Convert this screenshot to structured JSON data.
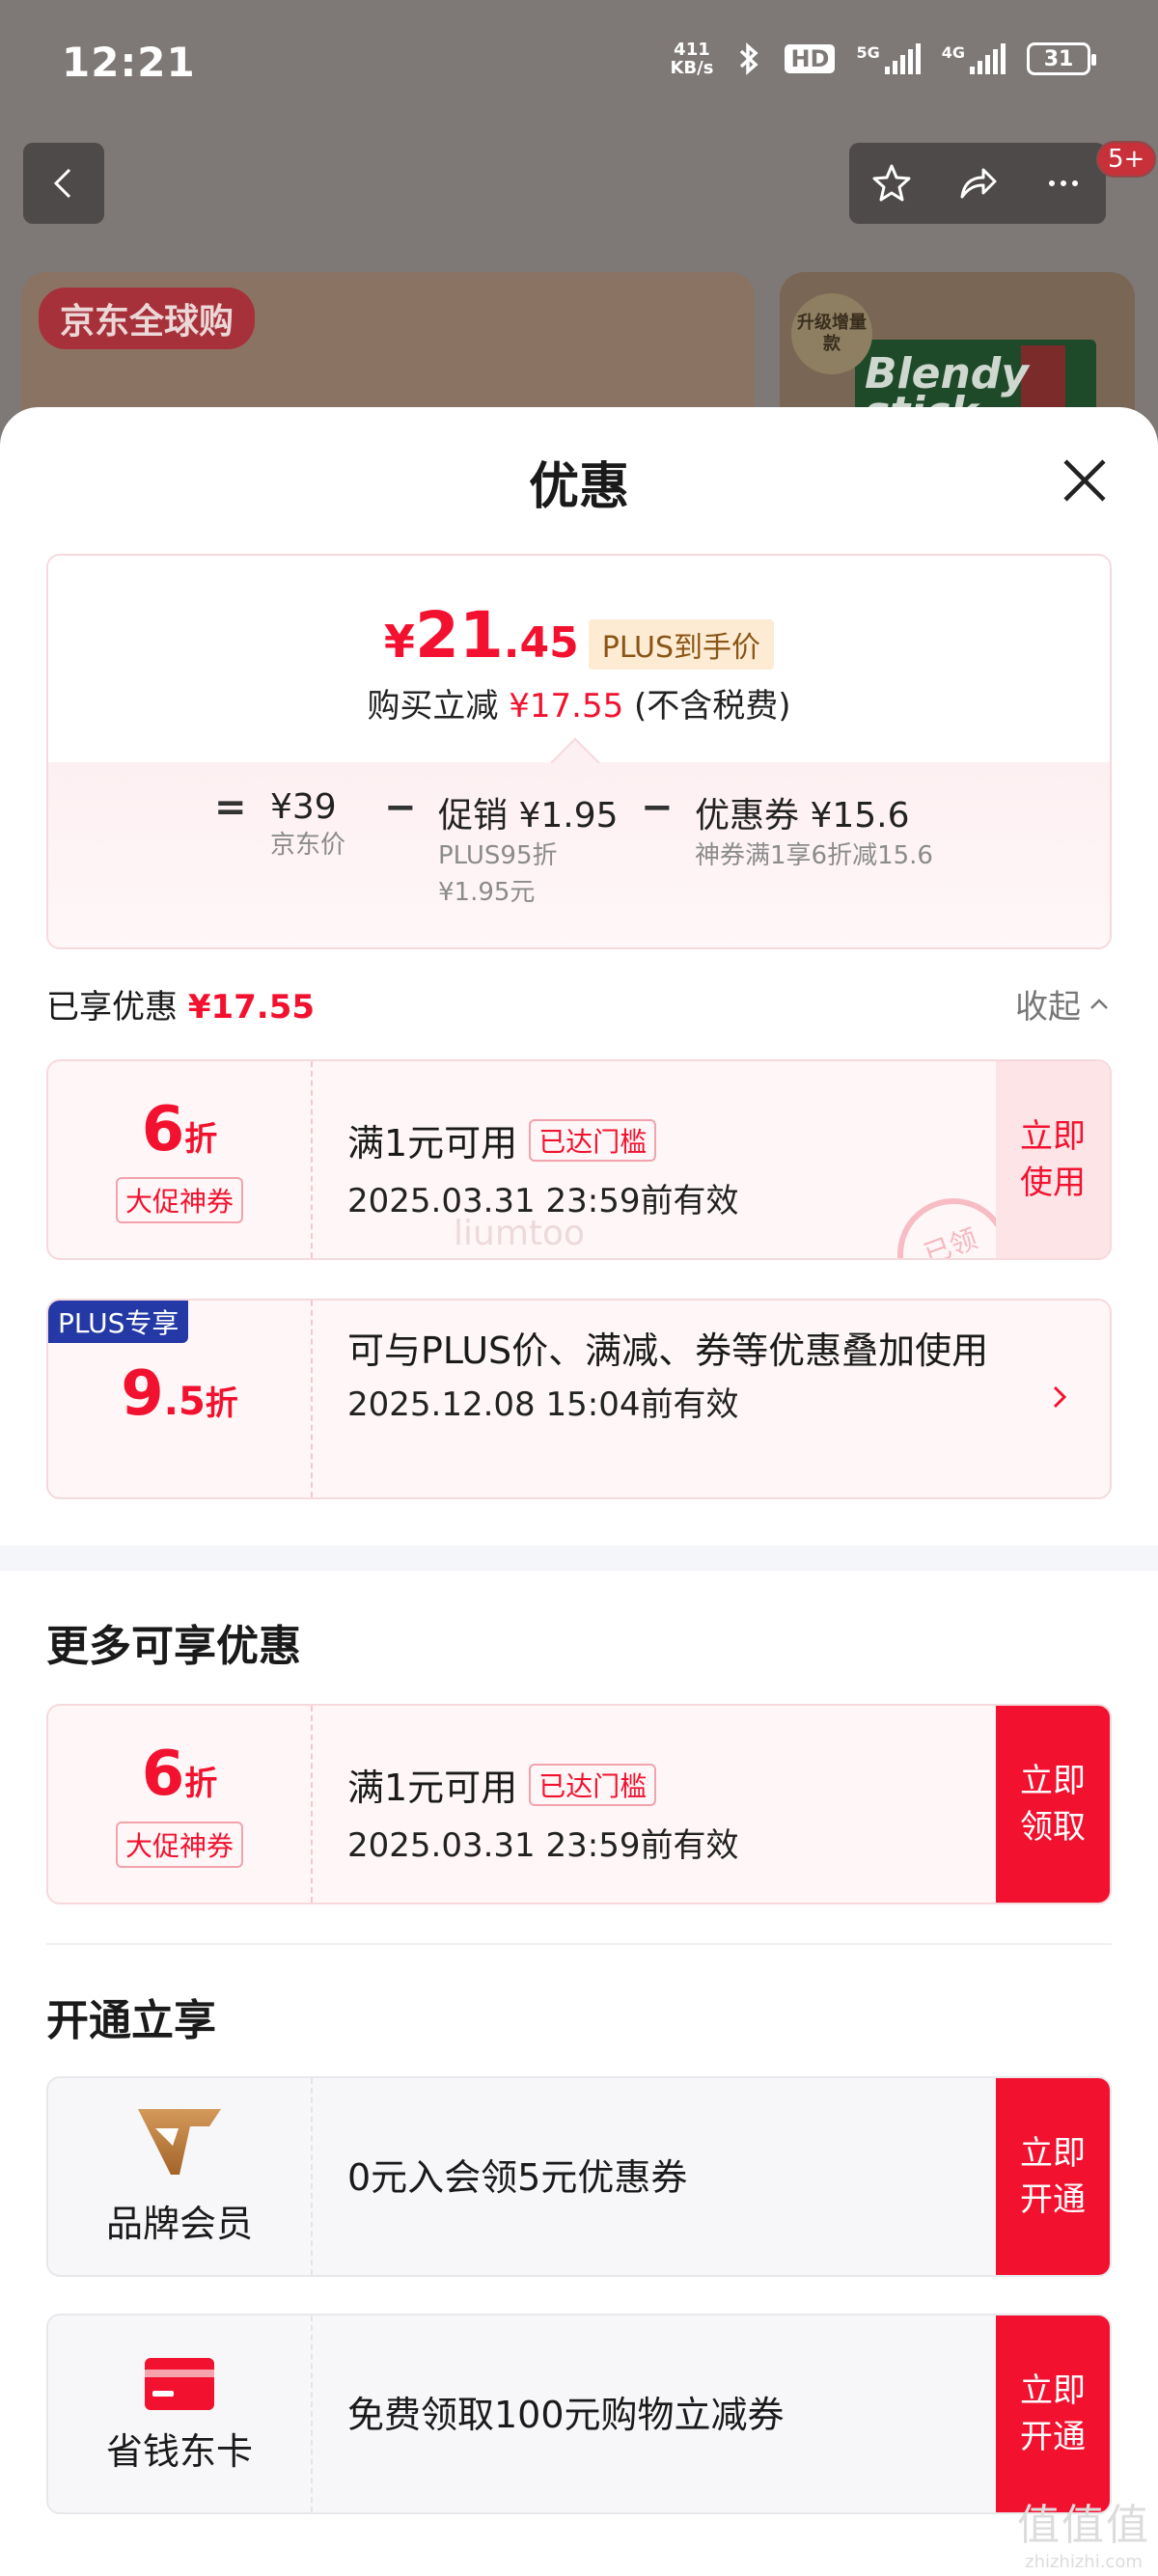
{
  "status_bar": {
    "time": "12:21",
    "speed_value": "411",
    "speed_unit": "KB/s",
    "hd_label": "HD",
    "net1": "5G",
    "net2": "4G",
    "battery": "31",
    "icons": [
      "bluetooth-icon",
      "signal-icon",
      "battery-icon"
    ]
  },
  "background_page": {
    "badge": "5+",
    "global_tag": "京东全球购",
    "upgrade_tag": "升级增量款",
    "product_text": "Blendy stick"
  },
  "sheet": {
    "title": "优惠"
  },
  "price_card": {
    "yen": "¥",
    "int": "21",
    "dec": ".45",
    "plus_tag": "PLUS到手价",
    "save_prefix": "购买立减",
    "save_amount": "¥17.55",
    "save_suffix": "(不含税费)",
    "eq": "=",
    "minus": "−",
    "jd_price": "¥39",
    "jd_price_label": "京东价",
    "promo_title": "促销 ¥1.95",
    "promo_sub1": "PLUS95折",
    "promo_sub2": "¥1.95元",
    "coupon_title": "优惠券 ¥15.6",
    "coupon_sub": "神券满1享6折减15.6"
  },
  "enjoyed": {
    "label": "已享优惠",
    "amount": "¥17.55",
    "collapse": "收起"
  },
  "coupons_enjoyed": [
    {
      "num": "6",
      "unit": "折",
      "tag": "大促神券",
      "condition": "满1元可用",
      "reached": "已达门槛",
      "validity": "2025.03.31 23:59前有效",
      "action": "立即\n使用",
      "stamp": "已领",
      "watermark": "liumtoo"
    },
    {
      "ribbon": "PLUS专享",
      "num": "9",
      "num_small": ".5",
      "unit": "折",
      "desc": "可与PLUS价、满减、券等优惠叠加使用",
      "validity": "2025.12.08 15:04前有效"
    }
  ],
  "more": {
    "title": "更多可享优惠",
    "coupon": {
      "num": "6",
      "unit": "折",
      "tag": "大促神券",
      "condition": "满1元可用",
      "reached": "已达门槛",
      "validity": "2025.03.31 23:59前有效",
      "action": "立即\n领取"
    }
  },
  "open": {
    "title": "开通立享",
    "items": [
      {
        "label": "品牌会员",
        "desc": "0元入会领5元优惠券",
        "action": "立即\n开通",
        "icon": "brand-member-v-icon"
      },
      {
        "label": "省钱东卡",
        "desc": "免费领取100元购物立减券",
        "action": "立即\n开通",
        "icon": "card-icon"
      }
    ]
  },
  "corner_watermark": {
    "w1": "值值值",
    "w2": "zhizhizhi.com"
  },
  "colors": {
    "accent_red": "#f2122f",
    "plus_blue": "#2439a6",
    "plus_gold": "#8a5515"
  }
}
